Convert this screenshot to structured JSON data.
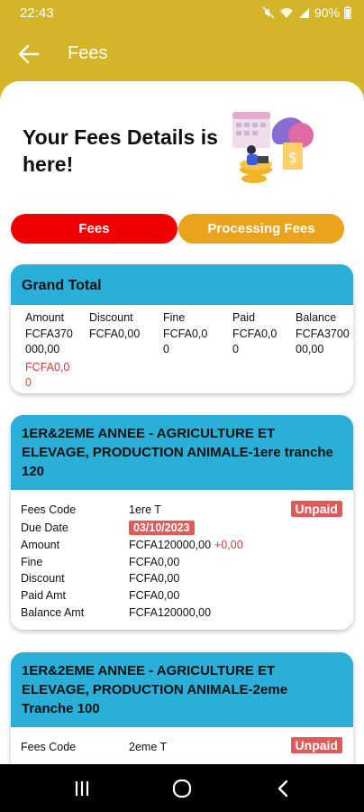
{
  "status_bar": {
    "time": "22:43",
    "battery": "90%"
  },
  "app_bar": {
    "title": "Fees"
  },
  "hero": {
    "title": "Your Fees Details is here!"
  },
  "tabs": [
    {
      "label": "Fees"
    },
    {
      "label": "Processing Fees"
    }
  ],
  "grand_total": {
    "title": "Grand Total",
    "columns": [
      {
        "label": "Amount",
        "value": "FCFA370000,00",
        "extra": "FCFA0,00"
      },
      {
        "label": "Discount",
        "value": "FCFA0,00"
      },
      {
        "label": "Fine",
        "value": "FCFA0,00"
      },
      {
        "label": "Paid",
        "value": "FCFA0,00"
      },
      {
        "label": "Balance",
        "value": "FCFA370000,00"
      }
    ]
  },
  "fees": [
    {
      "title": "1ER&2EME ANNEE - AGRICULTURE ET ELEVAGE, PRODUCTION ANIMALE-1ere tranche 120",
      "status": "Unpaid",
      "rows": {
        "fees_code": {
          "label": "Fees Code",
          "value": "1ere T"
        },
        "due_date": {
          "label": "Due Date",
          "value": "03/10/2023"
        },
        "amount": {
          "label": "Amount",
          "value": "FCFA120000,00",
          "extra": "+0,00"
        },
        "fine": {
          "label": "Fine",
          "value": "FCFA0,00"
        },
        "discount": {
          "label": "Discount",
          "value": "FCFA0,00"
        },
        "paid_amt": {
          "label": "Paid Amt",
          "value": "FCFA0,00"
        },
        "balance_amt": {
          "label": "Balance Amt",
          "value": "FCFA120000,00"
        }
      }
    },
    {
      "title": "1ER&2EME ANNEE - AGRICULTURE ET ELEVAGE, PRODUCTION ANIMALE-2eme Tranche 100",
      "status": "Unpaid",
      "rows": {
        "fees_code": {
          "label": "Fees Code",
          "value": "2eme T"
        }
      }
    }
  ],
  "colors": {
    "brand": "#d4b52a",
    "card_header": "#29afd8",
    "tab_active": "#f00000",
    "tab_inactive": "#eba21d",
    "badge": "#e15a5a"
  }
}
